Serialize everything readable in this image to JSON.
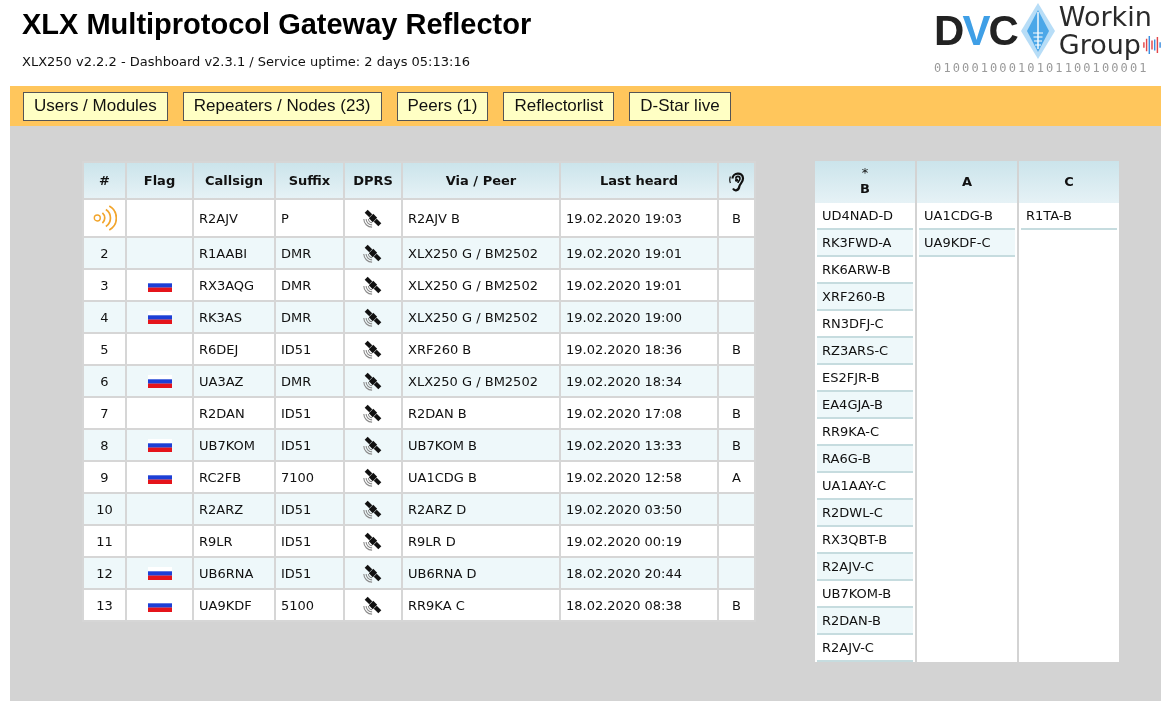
{
  "header": {
    "title": "XLX Multiprotocol Gateway Reflector",
    "subtitle": "XLX250 v2.2.2 - Dashboard v2.3.1 / Service uptime: 2 days 05:13:16"
  },
  "logo": {
    "letters": "DVC",
    "name_lines": [
      "Workin",
      "Group"
    ],
    "binary": "01000100010101100100001"
  },
  "nav": [
    "Users / Modules",
    "Repeaters / Nodes (23)",
    "Peers (1)",
    "Reflectorlist",
    "D-Star live"
  ],
  "last_heard_table": {
    "columns": [
      "#",
      "Flag",
      "Callsign",
      "Suffix",
      "DPRS",
      "Via / Peer",
      "Last heard"
    ],
    "rows": [
      {
        "transmitting": true,
        "flag": false,
        "callsign": "R2AJV",
        "suffix": "P",
        "via": "R2AJV B",
        "last_heard": "19.02.2020 19:03",
        "module": "B"
      },
      {
        "transmitting": false,
        "number": "2",
        "flag": false,
        "callsign": "R1AABI",
        "suffix": "DMR",
        "via": "XLX250 G / BM2502",
        "last_heard": "19.02.2020 19:01"
      },
      {
        "transmitting": false,
        "number": "3",
        "flag": true,
        "callsign": "RX3AQG",
        "suffix": "DMR",
        "via": "XLX250 G / BM2502",
        "last_heard": "19.02.2020 19:01"
      },
      {
        "transmitting": false,
        "number": "4",
        "flag": true,
        "callsign": "RK3AS",
        "suffix": "DMR",
        "via": "XLX250 G / BM2502",
        "last_heard": "19.02.2020 19:00"
      },
      {
        "transmitting": false,
        "number": "5",
        "flag": false,
        "callsign": "R6DEJ",
        "suffix": "ID51",
        "via": "XRF260 B",
        "last_heard": "19.02.2020 18:36",
        "module": "B"
      },
      {
        "transmitting": false,
        "number": "6",
        "flag": true,
        "callsign": "UA3AZ",
        "suffix": "DMR",
        "via": "XLX250 G / BM2502",
        "last_heard": "19.02.2020 18:34"
      },
      {
        "transmitting": false,
        "number": "7",
        "flag": false,
        "callsign": "R2DAN",
        "suffix": "ID51",
        "via": "R2DAN B",
        "last_heard": "19.02.2020 17:08",
        "module": "B"
      },
      {
        "transmitting": false,
        "number": "8",
        "flag": true,
        "callsign": "UB7KOM",
        "suffix": "ID51",
        "via": "UB7KOM B",
        "last_heard": "19.02.2020 13:33",
        "module": "B"
      },
      {
        "transmitting": false,
        "number": "9",
        "flag": true,
        "callsign": "RC2FB",
        "suffix": "7100",
        "via": "UA1CDG B",
        "last_heard": "19.02.2020 12:58",
        "module": "A"
      },
      {
        "transmitting": false,
        "number": "10",
        "flag": false,
        "callsign": "R2ARZ",
        "suffix": "ID51",
        "via": "R2ARZ D",
        "last_heard": "19.02.2020 03:50"
      },
      {
        "transmitting": false,
        "number": "11",
        "flag": false,
        "callsign": "R9LR",
        "suffix": "ID51",
        "via": "R9LR D",
        "last_heard": "19.02.2020 00:19"
      },
      {
        "transmitting": false,
        "number": "12",
        "flag": true,
        "callsign": "UB6RNA",
        "suffix": "ID51",
        "via": "UB6RNA D",
        "last_heard": "18.02.2020 20:44"
      },
      {
        "transmitting": false,
        "number": "13",
        "flag": true,
        "callsign": "UA9KDF",
        "suffix": "5100",
        "via": "RR9KA C",
        "last_heard": "18.02.2020 08:38",
        "module": "B"
      }
    ]
  },
  "modules": [
    {
      "marker": "*",
      "name": "B",
      "users": [
        "UD4NAD-D",
        "RK3FWD-A",
        "RK6ARW-B",
        "XRF260-B",
        "RN3DFJ-C",
        "RZ3ARS-C",
        "ES2FJR-B",
        "EA4GJA-B",
        "RR9KA-C",
        "RA6G-B",
        "UA1AAY-C",
        "R2DWL-C",
        "RX3QBT-B",
        "R2AJV-C",
        "UB7KOM-B",
        "R2DAN-B",
        "R2AJV-C"
      ]
    },
    {
      "name": "A",
      "users": [
        "UA1CDG-B",
        "UA9KDF-C"
      ]
    },
    {
      "name": "C",
      "users": [
        "R1TA-B"
      ]
    }
  ]
}
